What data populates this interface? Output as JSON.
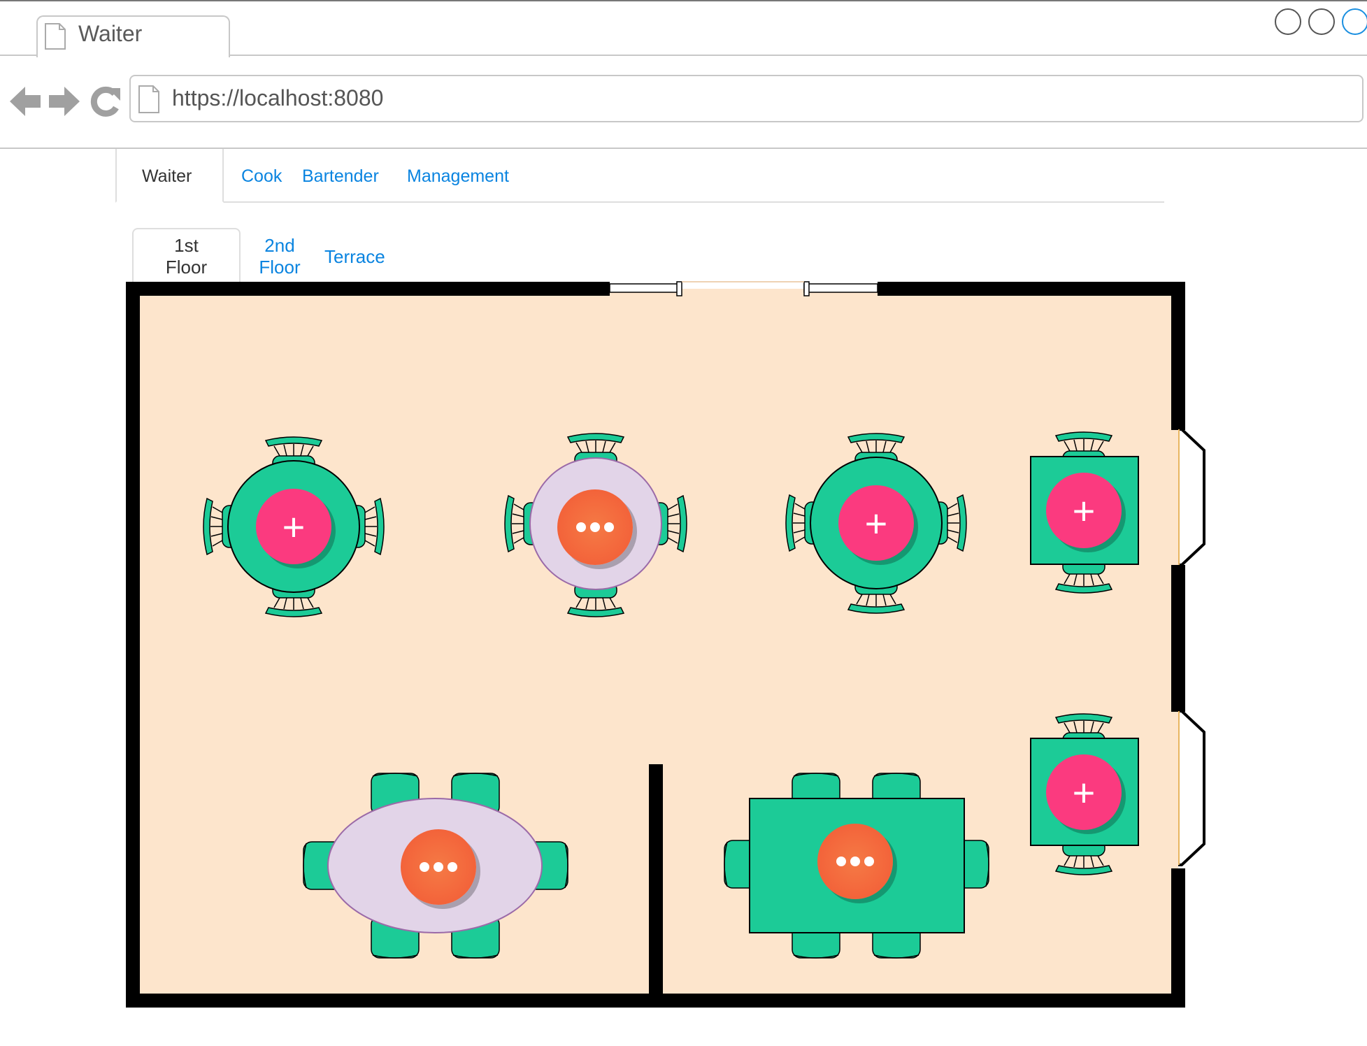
{
  "browser": {
    "tab_title": "Waiter",
    "url": "https://localhost:8080"
  },
  "nav": {
    "tabs": [
      {
        "label": "Waiter",
        "active": true
      },
      {
        "label": "Cook",
        "active": false
      },
      {
        "label": "Bartender",
        "active": false
      },
      {
        "label": "Management",
        "active": false
      }
    ]
  },
  "floors": {
    "tabs": [
      {
        "label_line1": "1st",
        "label_line2": "Floor",
        "active": true
      },
      {
        "label_line1": "2nd",
        "label_line2": "Floor",
        "active": false
      },
      {
        "label_line1": "Terrace",
        "label_line2": "",
        "active": false
      }
    ]
  },
  "floorplan": {
    "tables": [
      {
        "shape": "round",
        "status": "free",
        "action_icon": "plus-icon",
        "action_label": "+"
      },
      {
        "shape": "round",
        "status": "occupied",
        "action_icon": "more-icon"
      },
      {
        "shape": "round",
        "status": "free",
        "action_icon": "plus-icon",
        "action_label": "+"
      },
      {
        "shape": "square",
        "status": "free",
        "action_icon": "plus-icon",
        "action_label": "+"
      },
      {
        "shape": "square",
        "status": "free",
        "action_icon": "plus-icon",
        "action_label": "+"
      },
      {
        "shape": "oval",
        "status": "occupied",
        "action_icon": "more-icon"
      },
      {
        "shape": "rectangle",
        "status": "occupied",
        "action_icon": "more-icon"
      }
    ]
  },
  "colors": {
    "floor": "#fde5cc",
    "wall": "#000000",
    "table": "#1ccb97",
    "occupied_table": "#e2d4e8",
    "free_button": "#fb3a7f",
    "occupied_button": "#f3633a",
    "link": "#0a84e0"
  }
}
